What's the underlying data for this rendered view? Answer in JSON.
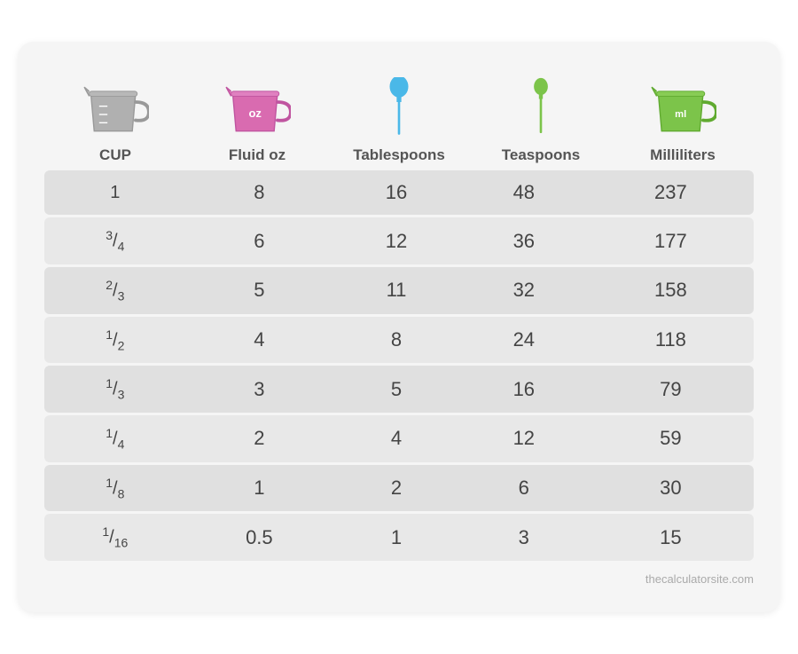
{
  "headers": [
    {
      "label": "CUP",
      "icon": "cup-gray"
    },
    {
      "label": "Fluid oz",
      "icon": "cup-pink-oz"
    },
    {
      "label": "Tablespoons",
      "icon": "spoon-blue"
    },
    {
      "label": "Teaspoons",
      "icon": "spoon-green"
    },
    {
      "label": "Milliliters",
      "icon": "cup-green-ml"
    }
  ],
  "rows": [
    {
      "cup": "1",
      "floz": "8",
      "tbsp": "16",
      "tsp": "48",
      "ml": "237"
    },
    {
      "cup": "¾",
      "floz": "6",
      "tbsp": "12",
      "tsp": "36",
      "ml": "177"
    },
    {
      "cup": "⅔",
      "floz": "5",
      "tbsp": "11",
      "tsp": "32",
      "ml": "158"
    },
    {
      "cup": "½",
      "floz": "4",
      "tbsp": "8",
      "tsp": "24",
      "ml": "118"
    },
    {
      "cup": "⅓",
      "floz": "3",
      "tbsp": "5",
      "tsp": "16",
      "ml": "79"
    },
    {
      "cup": "¼",
      "floz": "2",
      "tbsp": "4",
      "tsp": "12",
      "ml": "59"
    },
    {
      "cup": "⅛",
      "floz": "1",
      "tbsp": "2",
      "tsp": "6",
      "ml": "30"
    },
    {
      "cup": "¹⁄₁₆",
      "floz": "0.5",
      "tbsp": "1",
      "tsp": "3",
      "ml": "15"
    }
  ],
  "watermark": "thecalculatorsite.com",
  "colors": {
    "cup_gray": "#a0a0a0",
    "cup_pink": "#d96bb0",
    "spoon_blue": "#4ab8e8",
    "spoon_green": "#7cc44a",
    "cup_green": "#7cc44a"
  }
}
